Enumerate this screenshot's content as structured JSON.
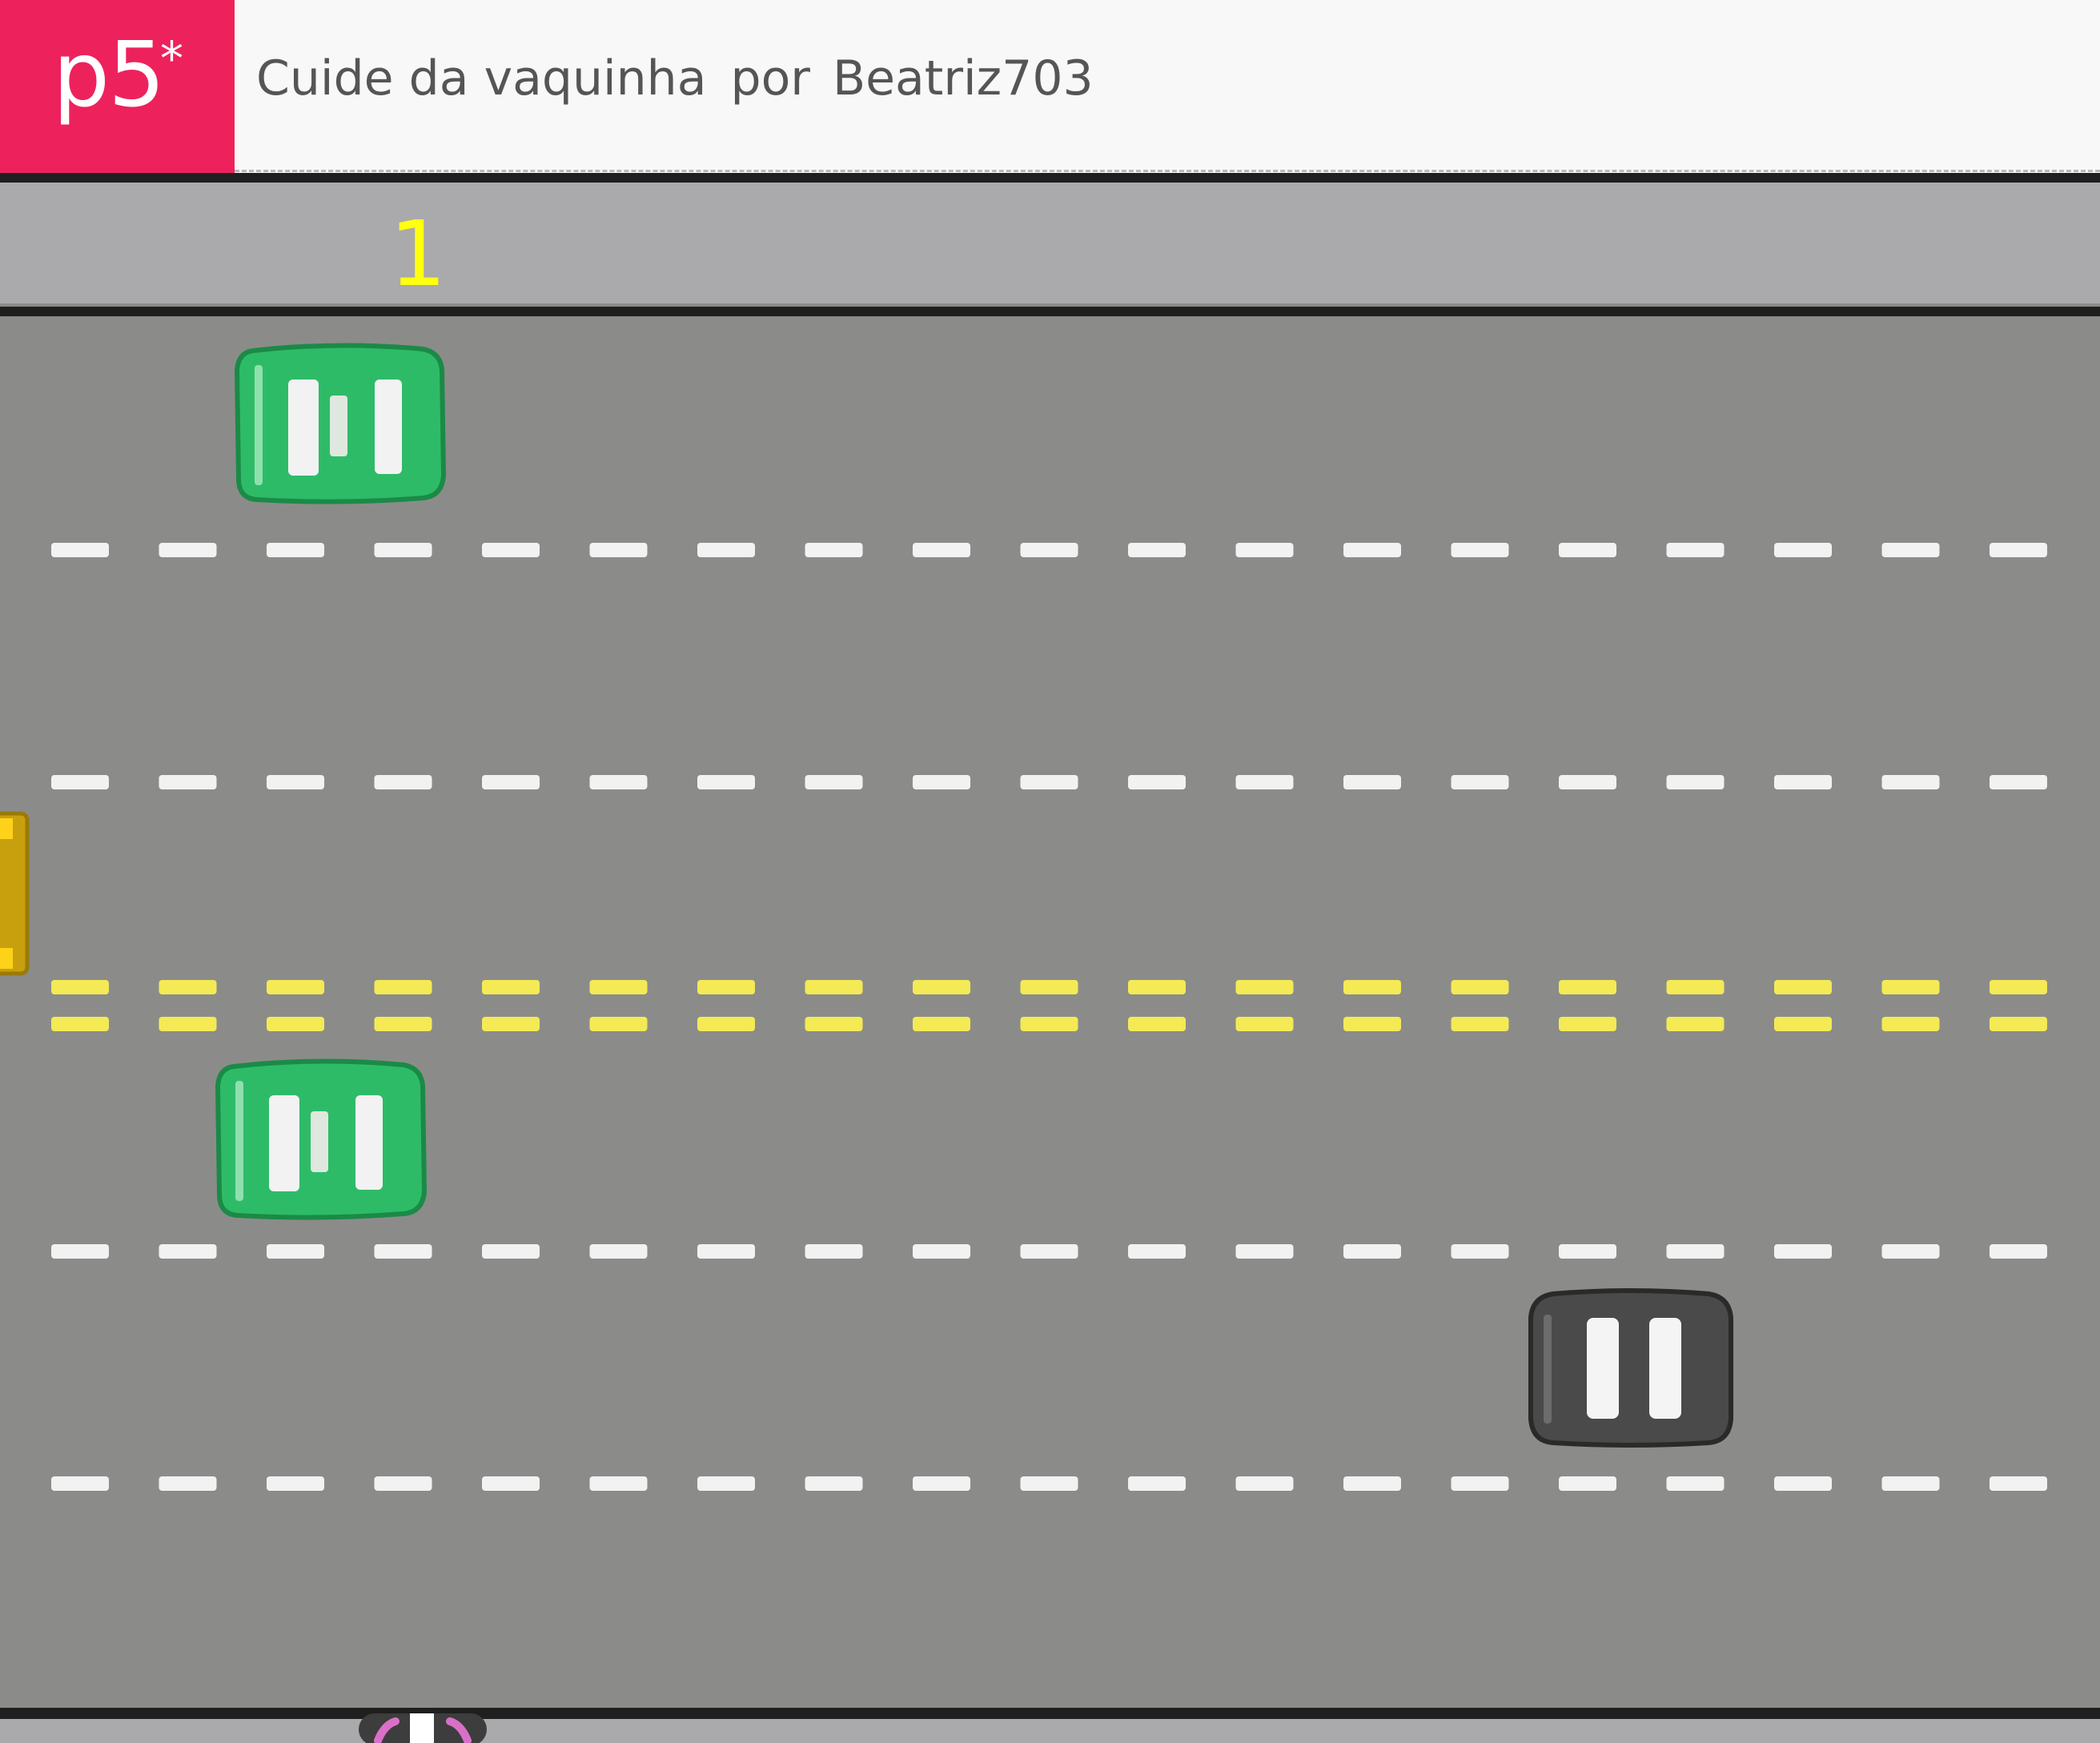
{
  "header": {
    "logo_text": "p5",
    "logo_star": "*",
    "sketch_name": "Cuide da vaquinha",
    "by_word": "por",
    "author": "Beatriz703"
  },
  "game": {
    "score": "1",
    "colors": {
      "asphalt": "#8b8c89",
      "sidewalk": "#aaa9ab",
      "curb": "#1f1f1f",
      "lane_line": "#f2f2f2",
      "center_line": "#f4ea55",
      "score": "#ffff10",
      "car_green": "#2ebb68",
      "car_black": "#4a4a4a",
      "car_yellow": "#c8a00e",
      "cow_pink": "#d970c8"
    },
    "lane_dividers": [
      "white-dashed",
      "white-dashed",
      "yellow-double-dashed",
      "white-dashed",
      "white-dashed"
    ],
    "cars": [
      {
        "name": "green-car-top",
        "color": "green",
        "lane": 1
      },
      {
        "name": "yellow-car-left",
        "color": "yellow",
        "lane": 2
      },
      {
        "name": "green-car-middle",
        "color": "green",
        "lane": 3
      },
      {
        "name": "black-car",
        "color": "black",
        "lane": 4
      }
    ],
    "player": {
      "name": "cow-player",
      "icon": "cow-icon"
    }
  }
}
